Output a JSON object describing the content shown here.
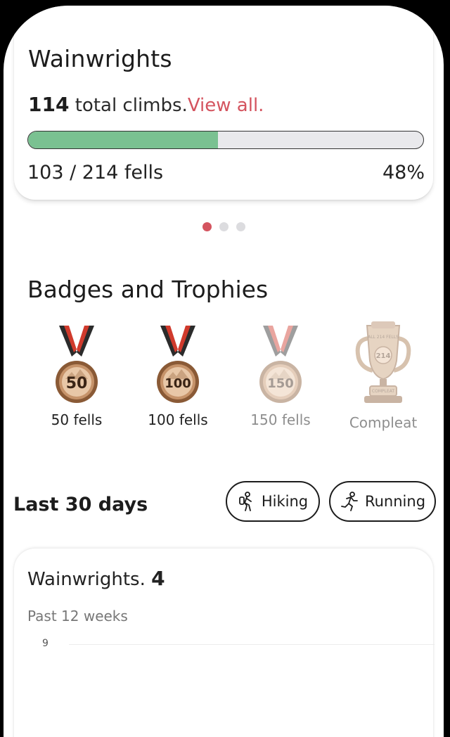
{
  "summary": {
    "title": "Wainwrights",
    "total_climbs": "114",
    "total_climbs_suffix": " total climbs.",
    "view_all": "View all.",
    "completed": 103,
    "total": 214,
    "progress_fraction": 0.48,
    "fells_text": "103 / 214 fells",
    "percent_text": "48%"
  },
  "pager": {
    "pages": 3,
    "active": 0
  },
  "badges": {
    "title": "Badges and Trophies",
    "items": [
      {
        "label": "50 fells",
        "value": "50",
        "earned": true,
        "icon": "medal-50-icon"
      },
      {
        "label": "100 fells",
        "value": "100",
        "earned": true,
        "icon": "medal-100-icon"
      },
      {
        "label": "150 fells",
        "value": "150",
        "earned": false,
        "icon": "medal-150-icon"
      },
      {
        "label": "Compleat",
        "value": "214",
        "earned": false,
        "icon": "trophy-icon",
        "trophy_text": [
          "ALL 214 FELLS",
          "COMPLEAT"
        ]
      }
    ]
  },
  "recent": {
    "title": "Last 30 days",
    "filters": [
      {
        "label": "Hiking",
        "icon": "hiker-icon"
      },
      {
        "label": "Running",
        "icon": "runner-icon"
      }
    ]
  },
  "weekly": {
    "title": "Wainwrights.",
    "count": "4",
    "subtitle": "Past 12 weeks",
    "y_tick": "9"
  },
  "colors": {
    "accent": "#d4545f",
    "progress": "#7ac191",
    "track": "#e9e9ec",
    "medal_ribbon_red": "#d03a2c",
    "medal_ribbon_dark": "#2b2b2b",
    "medal_gold": "#b07a4a"
  }
}
